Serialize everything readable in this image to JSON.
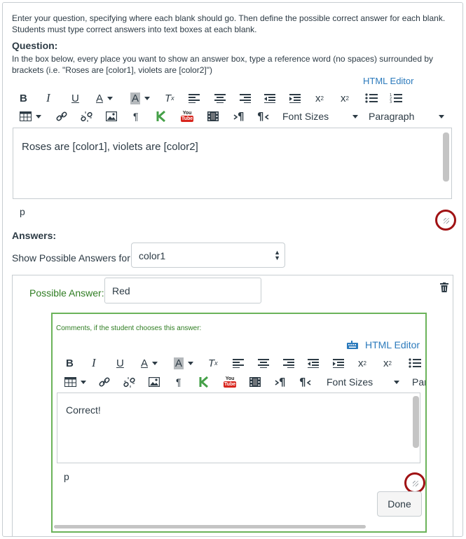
{
  "intro_text": "Enter your question, specifying where each blank should go. Then define the possible correct answer for each blank. Students must type correct answers into text boxes at each blank.",
  "question": {
    "label": "Question:",
    "help_text": "In the box below, every place you want to show an answer box, type a reference word (no spaces) surrounded by brackets (i.e. \"Roses are [color1], violets are [color2]\")",
    "html_editor_label": "HTML Editor",
    "font_sizes_label": "Font Sizes",
    "paragraph_label": "Paragraph",
    "editor_content": "Roses are [color1], violets are [color2]",
    "path_label": "p"
  },
  "answers": {
    "label": "Answers:",
    "show_label": "Show Possible Answers for",
    "selected_blank": "color1"
  },
  "answer_card": {
    "possible_label": "Possible Answer:",
    "answer_value": "Red",
    "comment_label": "Comments, if the student chooses this answer:",
    "html_editor_label": "HTML Editor",
    "font_sizes_label": "Font Sizes",
    "paragraph_partial": "Par",
    "editor_content": "Correct!",
    "path_label": "p",
    "done_label": "Done"
  },
  "icons": {
    "youtube_you": "You",
    "youtube_tube": "Tube"
  },
  "colors": {
    "link_blue": "#2b7abc",
    "comment_green": "#2f7d22",
    "comment_border": "#6bb35a",
    "highlight_circle": "#a01214"
  }
}
